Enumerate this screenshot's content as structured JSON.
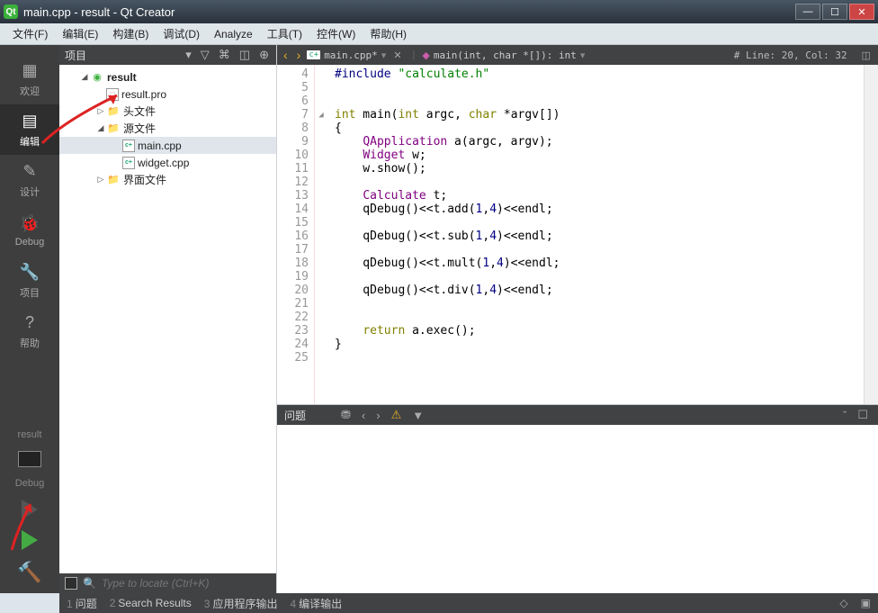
{
  "window": {
    "title": "main.cpp - result - Qt Creator"
  },
  "menu": [
    {
      "label": "文件(F)"
    },
    {
      "label": "编辑(E)"
    },
    {
      "label": "构建(B)"
    },
    {
      "label": "调试(D)"
    },
    {
      "label": "Analyze"
    },
    {
      "label": "工具(T)"
    },
    {
      "label": "控件(W)"
    },
    {
      "label": "帮助(H)"
    }
  ],
  "rail": {
    "welcome": "欢迎",
    "edit": "编辑",
    "design": "设计",
    "debug": "Debug",
    "project": "项目",
    "help": "帮助",
    "target": "result",
    "config": "Debug"
  },
  "project_panel": {
    "title": "项目",
    "root": "result",
    "pro_file": "result.pro",
    "headers": "头文件",
    "sources": "源文件",
    "src_main": "main.cpp",
    "src_widget": "widget.cpp",
    "forms": "界面文件",
    "locate_placeholder": "Type to locate (Ctrl+K)"
  },
  "editor": {
    "filename": "main.cpp*",
    "fn_diamond": "◆",
    "fn_sig": "main(int, char *[]): int",
    "status": "#  Line: 20, Col: 32",
    "lines": [
      {
        "n": 4,
        "t": "<span class='pp'>#include </span><span class='str'>\"calculate.h\"</span>"
      },
      {
        "n": 5,
        "t": ""
      },
      {
        "n": 6,
        "t": ""
      },
      {
        "n": 7,
        "t": "<span class='kw'>int</span> main(<span class='kw'>int</span> argc, <span class='kw'>char</span> *argv[])"
      },
      {
        "n": 8,
        "t": "{"
      },
      {
        "n": 9,
        "t": "    <span class='type'>QApplication</span> a(argc, argv);"
      },
      {
        "n": 10,
        "t": "    <span class='type'>Widget</span> w;"
      },
      {
        "n": 11,
        "t": "    w.show();"
      },
      {
        "n": 12,
        "t": ""
      },
      {
        "n": 13,
        "t": "    <span class='type'>Calculate</span> t;"
      },
      {
        "n": 14,
        "t": "    qDebug()&lt;&lt;t.add(<span class='num'>1</span>,<span class='num'>4</span>)&lt;&lt;endl;"
      },
      {
        "n": 15,
        "t": ""
      },
      {
        "n": 16,
        "t": "    qDebug()&lt;&lt;t.sub(<span class='num'>1</span>,<span class='num'>4</span>)&lt;&lt;endl;"
      },
      {
        "n": 17,
        "t": ""
      },
      {
        "n": 18,
        "t": "    qDebug()&lt;&lt;t.mult(<span class='num'>1</span>,<span class='num'>4</span>)&lt;&lt;endl;"
      },
      {
        "n": 19,
        "t": ""
      },
      {
        "n": 20,
        "t": "    qDebug()&lt;&lt;t.div(<span class='num'>1</span>,<span class='num'>4</span>)&lt;&lt;endl;"
      },
      {
        "n": 21,
        "t": ""
      },
      {
        "n": 22,
        "t": ""
      },
      {
        "n": 23,
        "t": "    <span class='kw'>return</span> a.exec();"
      },
      {
        "n": 24,
        "t": "}"
      },
      {
        "n": 25,
        "t": ""
      }
    ]
  },
  "issues": {
    "title": "问题"
  },
  "bottom": {
    "panels": [
      {
        "n": "1",
        "l": "问题"
      },
      {
        "n": "2",
        "l": "Search Results"
      },
      {
        "n": "3",
        "l": "应用程序输出"
      },
      {
        "n": "4",
        "l": "编译输出"
      }
    ]
  }
}
